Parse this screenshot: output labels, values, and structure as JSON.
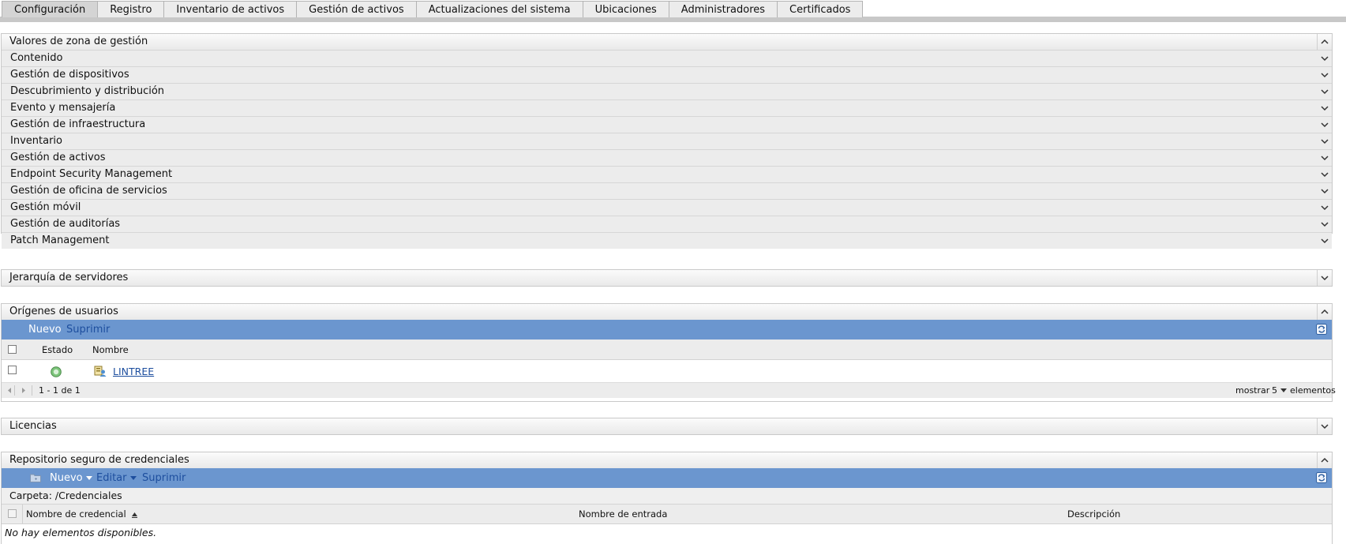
{
  "tabs": [
    {
      "label": "Configuración",
      "active": true
    },
    {
      "label": "Registro"
    },
    {
      "label": "Inventario de activos"
    },
    {
      "label": "Gestión de activos"
    },
    {
      "label": "Actualizaciones del sistema"
    },
    {
      "label": "Ubicaciones"
    },
    {
      "label": "Administradores"
    },
    {
      "label": "Certificados"
    }
  ],
  "zone": {
    "title": "Valores de zona de gestión",
    "sections": [
      "Contenido",
      "Gestión de dispositivos",
      "Descubrimiento y distribución",
      "Evento y mensajería",
      "Gestión de infraestructura",
      "Inventario",
      "Gestión de activos",
      "Endpoint Security Management",
      "Gestión de oficina de servicios",
      "Gestión móvil",
      "Gestión de auditorías",
      "Patch Management"
    ]
  },
  "hierarchy": {
    "title": "Jerarquía de servidores"
  },
  "user_sources": {
    "title": "Orígenes de usuarios",
    "toolbar": {
      "new": "Nuevo",
      "delete": "Suprimir"
    },
    "columns": {
      "status": "Estado",
      "name": "Nombre"
    },
    "rows": [
      {
        "name": "LINTREE",
        "status": "ok"
      }
    ],
    "pager": {
      "range": "1 - 1 de 1",
      "show": "mostrar",
      "count": "5",
      "items": "elementos"
    }
  },
  "licenses": {
    "title": "Licencias"
  },
  "vault": {
    "title": "Repositorio seguro de credenciales",
    "toolbar": {
      "new": "Nuevo",
      "edit": "Editar",
      "delete": "Suprimir"
    },
    "folder_label": "Carpeta:",
    "folder_path": "/Credenciales",
    "columns": {
      "name": "Nombre de credencial",
      "login": "Nombre de entrada",
      "description": "Descripción"
    },
    "empty": "No hay elementos disponibles."
  },
  "colors": {
    "toolbar": "#6b96cf",
    "link_active": "#1d4e9e",
    "toolbar_text": "#ffffff"
  }
}
